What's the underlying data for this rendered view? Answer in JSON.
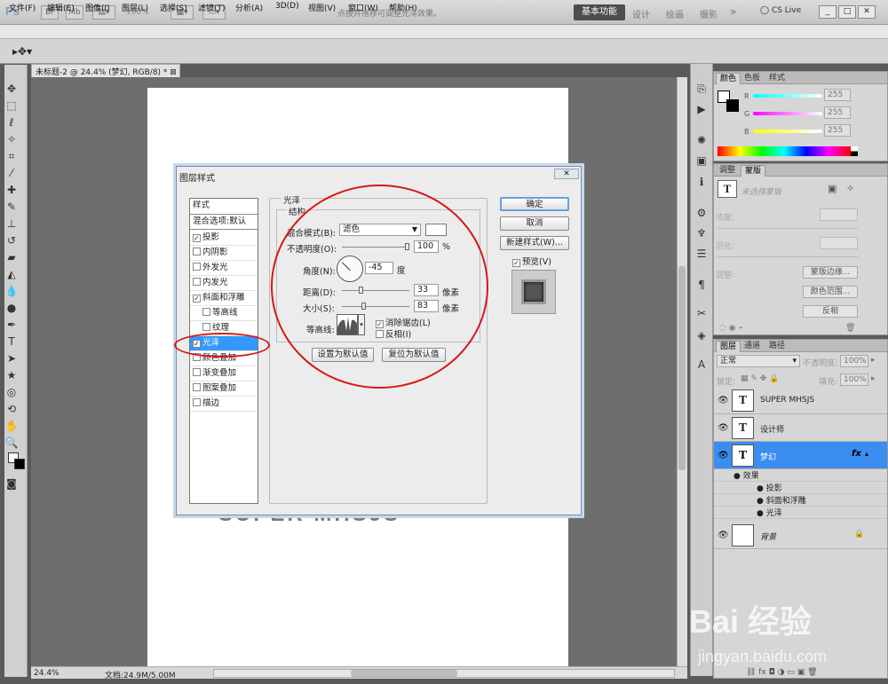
{
  "app": {
    "logo": "Ps",
    "zoom": "100%",
    "workspaces": [
      "基本功能",
      "设计",
      "绘画",
      "摄影"
    ],
    "more": "»",
    "cslive": "CS Live",
    "window_buttons": [
      "_",
      "□",
      "✕"
    ]
  },
  "menu": [
    "文件(F)",
    "编辑(E)",
    "图像(I)",
    "图层(L)",
    "选择(S)",
    "滤镜(T)",
    "分析(A)",
    "3D(D)",
    "视图(V)",
    "窗口(W)",
    "帮助(H)"
  ],
  "options": {
    "hint": "点按并拖移可调整光泽效果。"
  },
  "document": {
    "tab_title": "未标题-2 @ 24.4% (梦幻, RGB/8) *",
    "ghost_text": "SUPER MHSJS",
    "zoom": "24.4%",
    "doc_info": "文档:24.9M/5.00M"
  },
  "color_panel": {
    "tabs": [
      "颜色",
      "色板",
      "样式"
    ],
    "channels": [
      {
        "name": "R",
        "value": "255"
      },
      {
        "name": "G",
        "value": "255"
      },
      {
        "name": "B",
        "value": "255"
      }
    ]
  },
  "adjust_panel": {
    "tabs": [
      "调整",
      "蒙版"
    ],
    "mask_label": "未选择蒙版",
    "density": "浓度:",
    "feather": "羽化:",
    "refine": "调整:",
    "buttons": [
      "蒙版边缘...",
      "颜色范围...",
      "反相"
    ]
  },
  "layers_panel": {
    "tabs": [
      "图层",
      "通道",
      "路径"
    ],
    "blend_mode": "正常",
    "opacity_label": "不透明度:",
    "opacity": "100%",
    "lock_label": "锁定:",
    "fill_label": "填充:",
    "fill": "100%",
    "layers": [
      {
        "name": "SUPER MHSJS",
        "thumb": "T"
      },
      {
        "name": "设计师",
        "thumb": "T"
      },
      {
        "name": "梦幻",
        "thumb": "T",
        "fx": "fx"
      }
    ],
    "effects_header": "效果",
    "effects": [
      "投影",
      "斜面和浮雕",
      "光泽"
    ],
    "background": "背景"
  },
  "dialog": {
    "title": "图层样式",
    "close": "✕",
    "styles_header": "样式",
    "blend_options": "混合选项:默认",
    "style_items": [
      {
        "label": "投影",
        "checked": "✓"
      },
      {
        "label": "内阴影",
        "checked": ""
      },
      {
        "label": "外发光",
        "checked": ""
      },
      {
        "label": "内发光",
        "checked": ""
      },
      {
        "label": "斜面和浮雕",
        "checked": "✓"
      },
      {
        "label": "等高线",
        "checked": ""
      },
      {
        "label": "纹理",
        "checked": ""
      },
      {
        "label": "光泽",
        "checked": "✓"
      },
      {
        "label": "颜色叠加",
        "checked": ""
      },
      {
        "label": "渐变叠加",
        "checked": ""
      },
      {
        "label": "图案叠加",
        "checked": ""
      },
      {
        "label": "描边",
        "checked": ""
      }
    ],
    "section_title": "光泽",
    "group_title": "结构",
    "blend_mode_label": "混合模式(B):",
    "blend_mode": "滤色",
    "opacity_label": "不透明度(O):",
    "opacity": "100",
    "opacity_unit": "%",
    "angle_label": "角度(N):",
    "angle": "-45",
    "angle_unit": "度",
    "distance_label": "距离(D):",
    "distance": "33",
    "distance_unit": "像素",
    "size_label": "大小(S):",
    "size": "83",
    "size_unit": "像素",
    "contour_label": "等高线:",
    "antialias_label": "消除锯齿(L)",
    "invert_label": "反相(I)",
    "set_default": "设置为默认值",
    "reset_default": "复位为默认值",
    "ok": "确定",
    "cancel": "取消",
    "new_style": "新建样式(W)...",
    "preview_label": "预览(V)"
  },
  "watermark": {
    "brand": "Bai 经验",
    "url": "jingyan.baidu.com"
  }
}
